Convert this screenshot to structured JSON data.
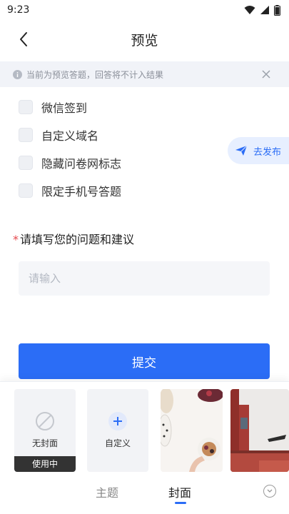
{
  "status_bar": {
    "time": "9:23"
  },
  "header": {
    "title": "预览"
  },
  "notice": {
    "text": "当前为预览答题，回答将不计入结果"
  },
  "options": [
    {
      "label": "微信签到"
    },
    {
      "label": "自定义域名"
    },
    {
      "label": "隐藏问卷网标志"
    },
    {
      "label": "限定手机号答题"
    }
  ],
  "publish": {
    "label": "去发布"
  },
  "question": {
    "required_mark": "*",
    "text": "请填写您的问题和建议",
    "placeholder": "请输入"
  },
  "submit": {
    "label": "提交"
  },
  "cover_panel": {
    "no_cover_label": "无封面",
    "in_use_label": "使用中",
    "custom_label": "自定义",
    "tabs": [
      "主题",
      "封面"
    ],
    "active_tab": "封面"
  },
  "colors": {
    "accent": "#2b6df6",
    "required": "#e5484d"
  }
}
